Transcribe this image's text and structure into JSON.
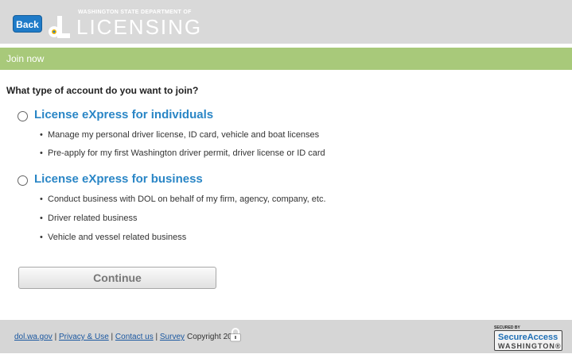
{
  "header": {
    "back_label": "Back",
    "logo_small": "WASHINGTON STATE DEPARTMENT OF",
    "logo_big": "LICENSING"
  },
  "band": {
    "title": "Join now"
  },
  "main": {
    "question": "What type of account do you want to join?",
    "options": [
      {
        "title": "License eXpress for individuals",
        "bullets": [
          "Manage my personal driver license, ID card, vehicle and boat licenses",
          "Pre-apply for my first Washington driver permit, driver license or ID card"
        ]
      },
      {
        "title": "License eXpress for business",
        "bullets": [
          "Conduct business with DOL on behalf of my firm, agency, company, etc.",
          "Driver related business",
          "Vehicle and vessel related business"
        ]
      }
    ],
    "continue_label": "Continue"
  },
  "footer": {
    "links": [
      "dol.wa.gov",
      "Privacy & Use",
      "Contact us",
      "Survey"
    ],
    "copyright": "Copyright 2018",
    "secure_top": "SECURED BY",
    "secure_line1": "SecureAccess",
    "secure_line2": "WASHINGTON®"
  },
  "colors": {
    "band": "#a8c97a",
    "link_blue": "#2a86c6",
    "back_button": "#1f7bc8"
  }
}
